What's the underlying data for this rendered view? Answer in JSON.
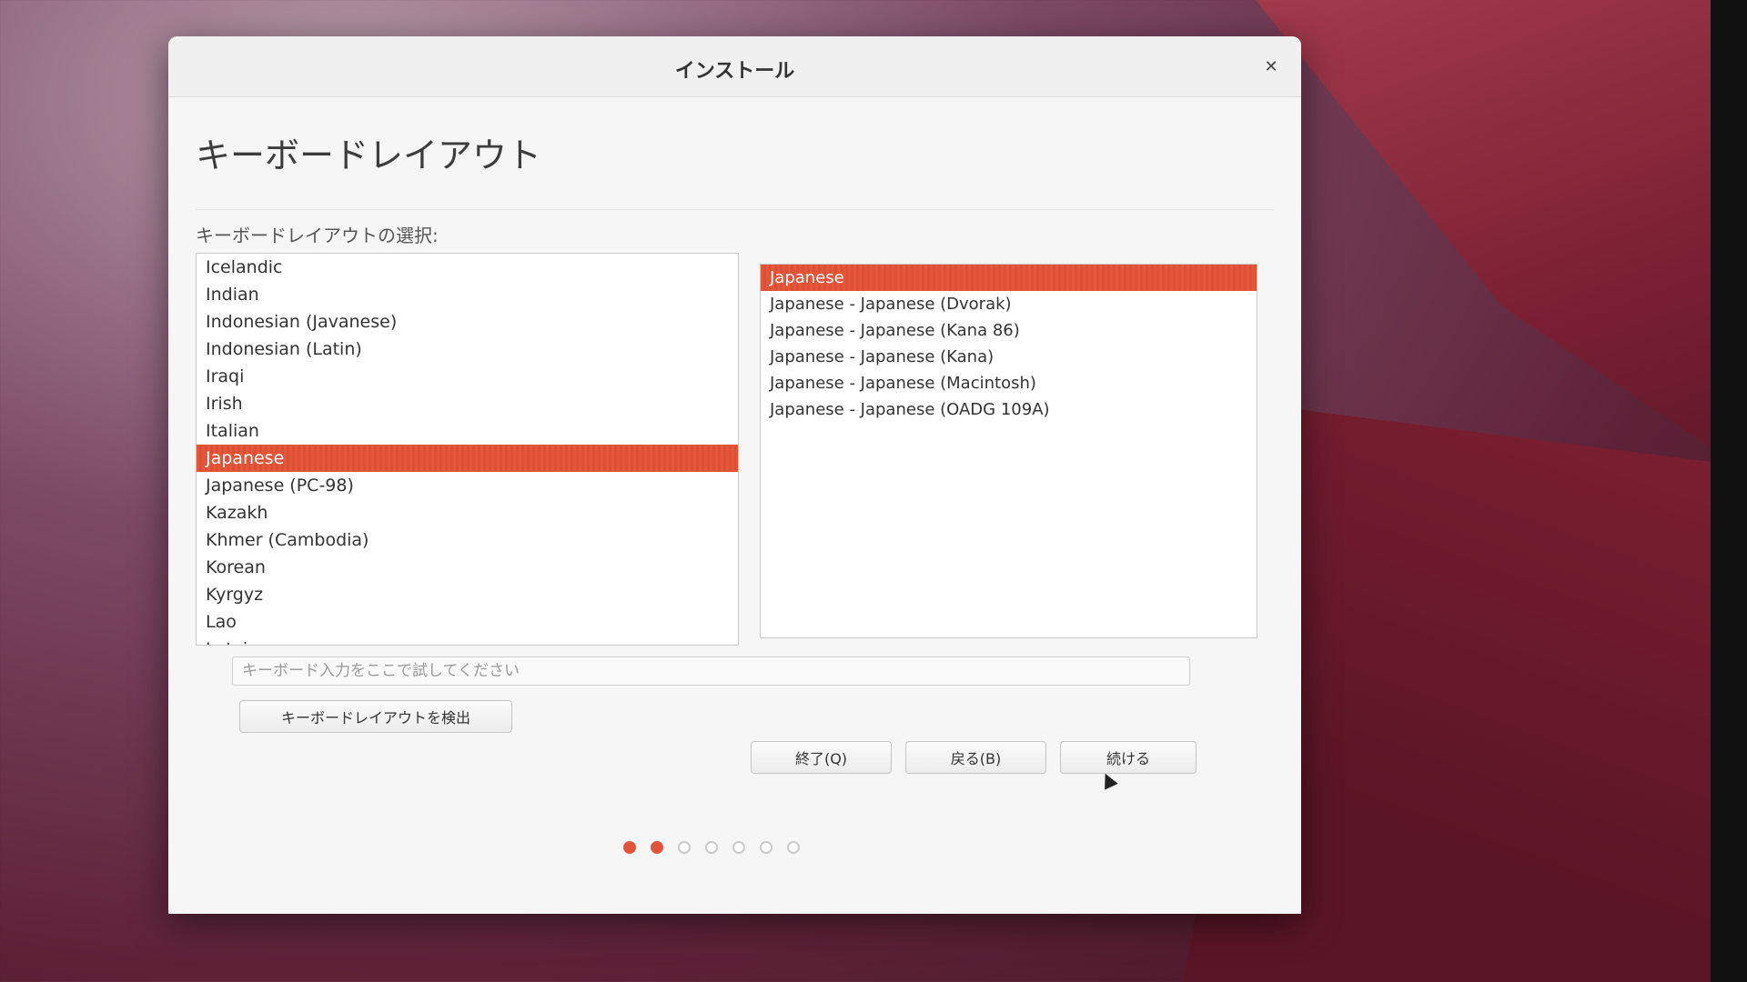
{
  "window": {
    "title": "インストール",
    "page_title": "キーボードレイアウト",
    "select_label": "キーボードレイアウトの選択:"
  },
  "layouts": {
    "items": [
      {
        "label": "Icelandic",
        "selected": false
      },
      {
        "label": "Indian",
        "selected": false
      },
      {
        "label": "Indonesian (Javanese)",
        "selected": false
      },
      {
        "label": "Indonesian (Latin)",
        "selected": false
      },
      {
        "label": "Iraqi",
        "selected": false
      },
      {
        "label": "Irish",
        "selected": false
      },
      {
        "label": "Italian",
        "selected": false
      },
      {
        "label": "Japanese",
        "selected": true
      },
      {
        "label": "Japanese (PC-98)",
        "selected": false
      },
      {
        "label": "Kazakh",
        "selected": false
      },
      {
        "label": "Khmer (Cambodia)",
        "selected": false
      },
      {
        "label": "Korean",
        "selected": false
      },
      {
        "label": "Kyrgyz",
        "selected": false
      },
      {
        "label": "Lao",
        "selected": false
      },
      {
        "label": "Latvian",
        "selected": false
      }
    ]
  },
  "variants": {
    "items": [
      {
        "label": "Japanese",
        "selected": true
      },
      {
        "label": "Japanese - Japanese (Dvorak)",
        "selected": false
      },
      {
        "label": "Japanese - Japanese (Kana 86)",
        "selected": false
      },
      {
        "label": "Japanese - Japanese (Kana)",
        "selected": false
      },
      {
        "label": "Japanese - Japanese (Macintosh)",
        "selected": false
      },
      {
        "label": "Japanese - Japanese (OADG 109A)",
        "selected": false
      }
    ]
  },
  "test_input": {
    "placeholder": "キーボード入力をここで試してください",
    "value": ""
  },
  "buttons": {
    "detect": "キーボードレイアウトを検出",
    "quit": "終了(Q)",
    "back": "戻る(B)",
    "continue": "続ける"
  },
  "progress": {
    "total_steps": 7,
    "completed_steps": 2
  },
  "colors": {
    "accent": "#e2543a",
    "selected_text": "#ffffff"
  }
}
